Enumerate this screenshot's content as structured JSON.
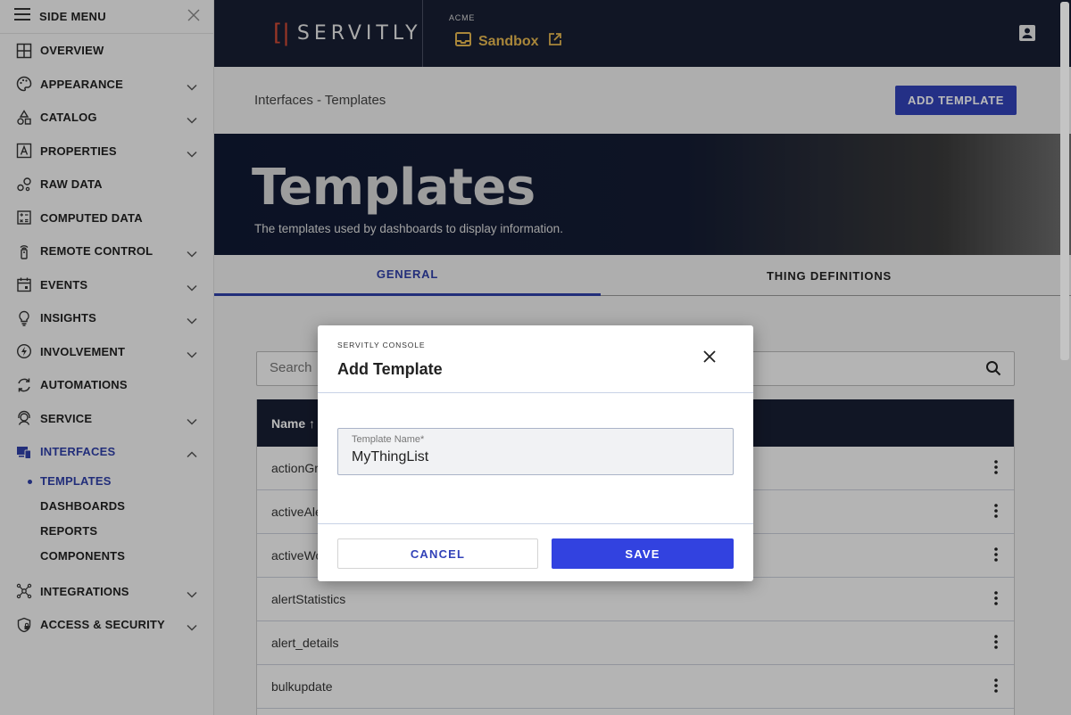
{
  "sidebar": {
    "title": "SIDE MENU",
    "items": [
      {
        "label": "OVERVIEW",
        "icon": "grid-icon",
        "chevron": false
      },
      {
        "label": "APPEARANCE",
        "icon": "palette-icon",
        "chevron": true
      },
      {
        "label": "CATALOG",
        "icon": "shapes-icon",
        "chevron": true
      },
      {
        "label": "PROPERTIES",
        "icon": "letter-a-box-icon",
        "chevron": true
      },
      {
        "label": "RAW DATA",
        "icon": "bubbles-icon",
        "chevron": false
      },
      {
        "label": "COMPUTED DATA",
        "icon": "calculator-icon",
        "chevron": false
      },
      {
        "label": "REMOTE CONTROL",
        "icon": "remote-icon",
        "chevron": true
      },
      {
        "label": "EVENTS",
        "icon": "calendar-icon",
        "chevron": true
      },
      {
        "label": "INSIGHTS",
        "icon": "lightbulb-icon",
        "chevron": true
      },
      {
        "label": "INVOLVEMENT",
        "icon": "bolt-circle-icon",
        "chevron": true
      },
      {
        "label": "AUTOMATIONS",
        "icon": "cycle-icon",
        "chevron": false
      },
      {
        "label": "SERVICE",
        "icon": "support-agent-icon",
        "chevron": true
      },
      {
        "label": "INTERFACES",
        "icon": "devices-icon",
        "chevron": true,
        "expanded": true
      },
      {
        "label": "INTEGRATIONS",
        "icon": "hub-icon",
        "chevron": true
      },
      {
        "label": "ACCESS & SECURITY",
        "icon": "shield-lock-icon",
        "chevron": true
      }
    ],
    "sub_items": [
      "TEMPLATES",
      "DASHBOARDS",
      "REPORTS",
      "COMPONENTS"
    ]
  },
  "topbar": {
    "logo_text": "SERVITLY",
    "org": "ACME",
    "app_name": "Sandbox"
  },
  "page": {
    "breadcrumb": "Interfaces - Templates",
    "add_button": "ADD TEMPLATE",
    "hero_title": "Templates",
    "hero_subtitle": "The templates used by dashboards to display information.",
    "tabs": [
      "GENERAL",
      "THING DEFINITIONS"
    ],
    "search_placeholder": "Search",
    "table_header": "Name ↑",
    "rows": [
      "actionGr",
      "activeAle",
      "activeWo",
      "alertStatistics",
      "alert_details",
      "bulkupdate"
    ]
  },
  "dialog": {
    "overline": "SERVITLY CONSOLE",
    "title": "Add Template",
    "field_label": "Template Name*",
    "field_value": "MyThingList",
    "cancel": "CANCEL",
    "save": "SAVE"
  },
  "colors": {
    "accent": "#3242b8",
    "topbar": "#181f33",
    "brand_gold": "#e6b850",
    "logo_red": "#d14b35"
  }
}
